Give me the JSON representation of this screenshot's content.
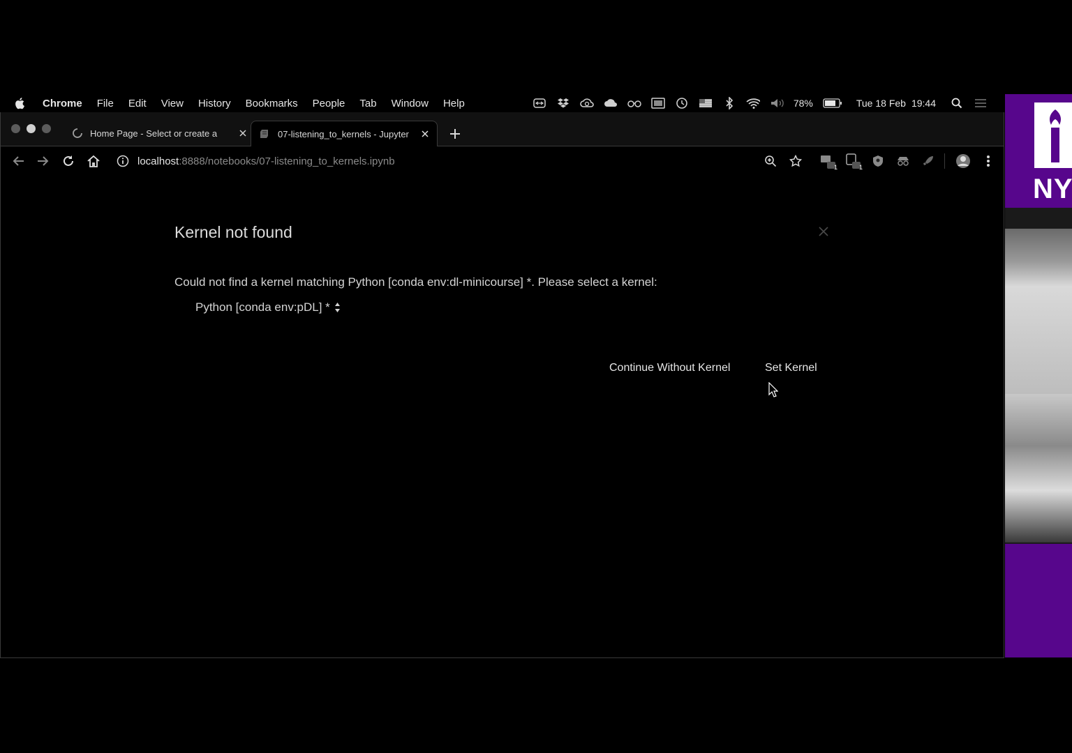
{
  "menubar": {
    "app": "Chrome",
    "items": [
      "File",
      "Edit",
      "View",
      "History",
      "Bookmarks",
      "People",
      "Tab",
      "Window",
      "Help"
    ],
    "status": {
      "battery": "78%",
      "date": "Tue 18 Feb",
      "time": "19:44"
    }
  },
  "browser": {
    "tabs": [
      {
        "title": "Home Page - Select or create a ",
        "active": false
      },
      {
        "title": "07-listening_to_kernels - Jupyter",
        "active": true
      }
    ],
    "url": {
      "host": "localhost",
      "path": ":8888/notebooks/07-listening_to_kernels.ipynb"
    },
    "extension_badges": [
      "1",
      "1"
    ]
  },
  "dialog": {
    "title": "Kernel not found",
    "message": "Could not find a kernel matching Python [conda env:dl-minicourse] *. Please select a kernel:",
    "kernel_selected": "Python [conda env:pDL] *",
    "continue_label": "Continue Without Kernel",
    "set_label": "Set Kernel"
  },
  "side_panel": {
    "logo_text": "NY"
  },
  "colors": {
    "background": "#000000",
    "nyu_purple": "#57068c"
  }
}
